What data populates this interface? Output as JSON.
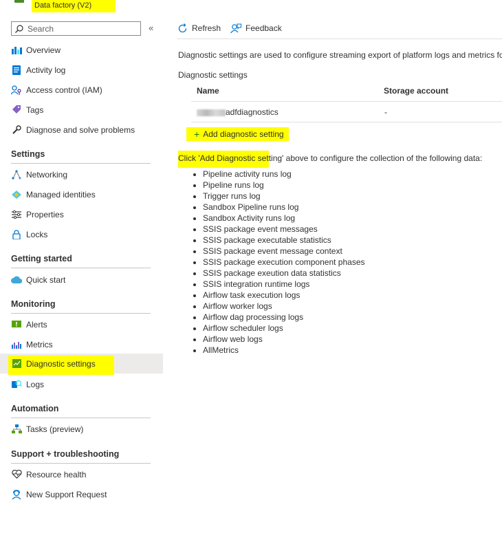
{
  "header": {
    "resource_type": "Data factory (V2)"
  },
  "sidebar": {
    "search_placeholder": "Search",
    "collapse_glyph": "«",
    "items_top": [
      {
        "label": "Overview",
        "icon": "overview-icon"
      },
      {
        "label": "Activity log",
        "icon": "activity-log-icon"
      },
      {
        "label": "Access control (IAM)",
        "icon": "iam-icon"
      },
      {
        "label": "Tags",
        "icon": "tag-icon"
      },
      {
        "label": "Diagnose and solve problems",
        "icon": "wrench-icon"
      }
    ],
    "sections": {
      "settings": "Settings",
      "getting_started": "Getting started",
      "monitoring": "Monitoring",
      "automation": "Automation",
      "support": "Support + troubleshooting"
    },
    "settings_items": [
      "Networking",
      "Managed identities",
      "Properties",
      "Locks"
    ],
    "getting_started_items": [
      "Quick start"
    ],
    "monitoring_items": [
      "Alerts",
      "Metrics",
      "Diagnostic settings",
      "Logs"
    ],
    "automation_items": [
      "Tasks (preview)"
    ],
    "support_items": [
      "Resource health",
      "New Support Request"
    ],
    "active_item": "Diagnostic settings"
  },
  "toolbar": {
    "refresh": "Refresh",
    "feedback": "Feedback"
  },
  "main": {
    "intro": "Diagnostic settings are used to configure streaming export of platform logs and metrics for",
    "diag_label": "Diagnostic settings",
    "table": {
      "headers": [
        "Name",
        "Storage account"
      ],
      "rows": [
        {
          "name_suffix": "adfdiagnostics",
          "storage": "-"
        }
      ]
    },
    "add_button": "Add diagnostic setting",
    "instruction_highlight": "Click 'Add Diagnostic set",
    "instruction_rest": "ting' above to configure the collection of the following data:",
    "data_items": [
      "Pipeline activity runs log",
      "Pipeline runs log",
      "Trigger runs log",
      "Sandbox Pipeline runs log",
      "Sandbox Activity runs log",
      "SSIS package event messages",
      "SSIS package executable statistics",
      "SSIS package event message context",
      "SSIS package execution component phases",
      "SSIS package exeution data statistics",
      "SSIS integration runtime logs",
      "Airflow task execution logs",
      "Airflow worker logs",
      "Airflow dag processing logs",
      "Airflow scheduler logs",
      "Airflow web logs",
      "AllMetrics"
    ]
  },
  "colors": {
    "highlight": "#ffff00",
    "active_bg": "#edebe9",
    "accent": "#0078d4",
    "add_plus": "#107c10"
  }
}
